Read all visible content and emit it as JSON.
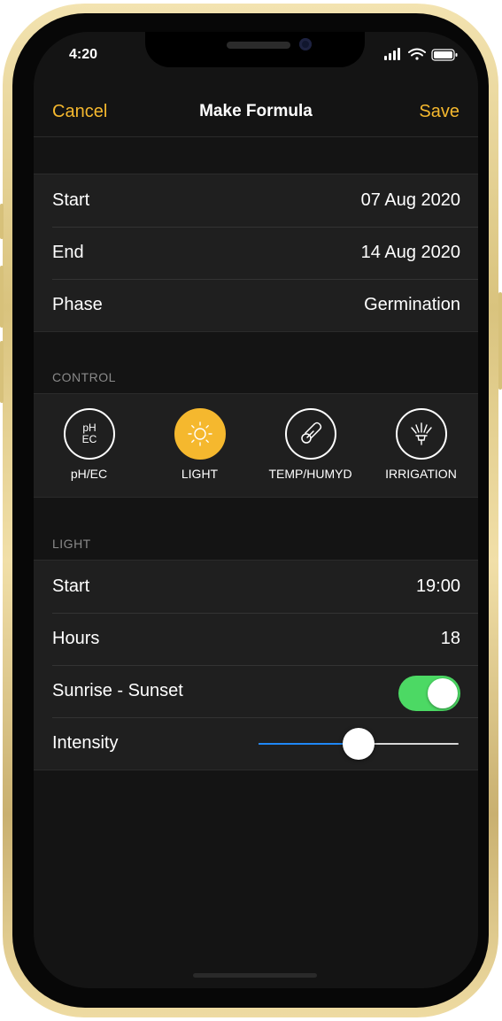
{
  "status_bar": {
    "time": "4:20"
  },
  "nav": {
    "cancel": "Cancel",
    "title": "Make Formula",
    "save": "Save"
  },
  "schedule": [
    {
      "label": "Start",
      "value": "07 Aug 2020"
    },
    {
      "label": "End",
      "value": "14 Aug 2020"
    },
    {
      "label": "Phase",
      "value": "Germination"
    }
  ],
  "control": {
    "header": "CONTROL",
    "items": [
      {
        "label": "pH/EC",
        "icon": "ph-ec-icon",
        "glyph_top": "pH",
        "glyph_bottom": "EC",
        "active": false
      },
      {
        "label": "LIGHT",
        "icon": "sun-icon",
        "active": true
      },
      {
        "label": "TEMP/HUMYD",
        "icon": "thermometer-icon",
        "active": false
      },
      {
        "label": "IRRIGATION",
        "icon": "sprinkler-icon",
        "active": false
      }
    ]
  },
  "light": {
    "header": "LIGHT",
    "start": {
      "label": "Start",
      "value": "19:00"
    },
    "hours": {
      "label": "Hours",
      "value": "18"
    },
    "sunrise_sunset": {
      "label": "Sunrise - Sunset",
      "on": true
    },
    "intensity": {
      "label": "Intensity",
      "level": 0.5
    }
  },
  "colors": {
    "accent": "#f5b82e",
    "toggle_on": "#4cd964",
    "slider_fill": "#1f87f5",
    "background": "#141414",
    "cell": "#1f1f1f"
  }
}
